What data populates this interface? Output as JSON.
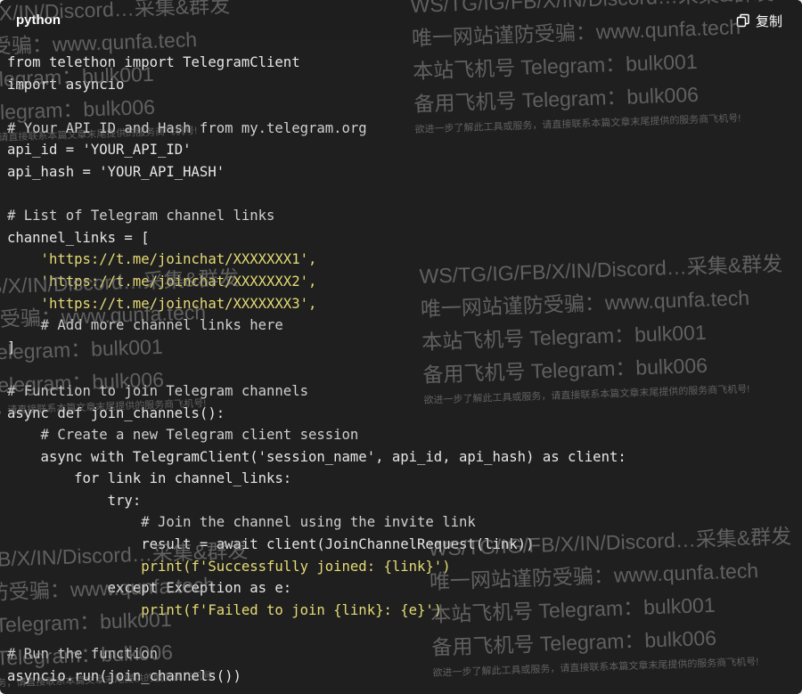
{
  "header": {
    "language": "python",
    "copy_label": "复制"
  },
  "code": {
    "lines": [
      "from telethon import TelegramClient",
      "import asyncio",
      "",
      "# Your API ID and Hash from my.telegram.org",
      "api_id = 'YOUR_API_ID'",
      "api_hash = 'YOUR_API_HASH'",
      "",
      "# List of Telegram channel links",
      "channel_links = [",
      "    'https://t.me/joinchat/XXXXXXX1',",
      "    'https://t.me/joinchat/XXXXXXX2',",
      "    'https://t.me/joinchat/XXXXXXX3',",
      "    # Add more channel links here",
      "]",
      "",
      "# Function to join Telegram channels",
      "async def join_channels():",
      "    # Create a new Telegram client session",
      "    async with TelegramClient('session_name', api_id, api_hash) as client:",
      "        for link in channel_links:",
      "            try:",
      "                # Join the channel using the invite link",
      "                result = await client(JoinChannelRequest(link))",
      "                print(f'Successfully joined: {link}')",
      "            except Exception as e:",
      "                print(f'Failed to join {link}: {e}')",
      "",
      "# Run the function",
      "asyncio.run(join_channels())"
    ]
  },
  "watermark": {
    "line1": "WS/TG/IG/FB/X/IN/Discord…采集&群发",
    "line2": "唯一网站谨防受骗：www.qunfa.tech",
    "line3": "本站飞机号 Telegram：bulk001",
    "line4": "备用飞机号 Telegram：bulk006",
    "line5": "欲进一步了解此工具或服务，请直接联系本篇文章末尾提供的服务商飞机号!"
  }
}
